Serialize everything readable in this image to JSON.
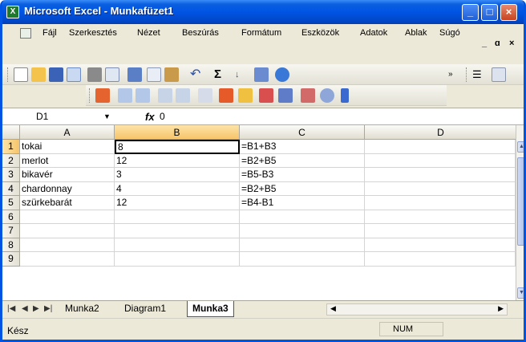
{
  "window": {
    "title": "Microsoft Excel - Munkafüzet1",
    "app_icon_glyph": "X",
    "minimize": "_",
    "maximize": "□",
    "close": "×"
  },
  "menu": {
    "items": [
      "Fájl",
      "Szerkesztés",
      "Nézet",
      "Beszúrás",
      "Formátum",
      "Eszközök",
      "Adatok",
      "Ablak",
      "Súgó"
    ],
    "doc_minimize": "_",
    "doc_restore": "ɑ",
    "doc_close": "×"
  },
  "toolbar": {
    "sigma": "Σ",
    "standard_icons": [
      "new-icon",
      "open-icon",
      "save-icon",
      "permission-icon",
      "print-icon",
      "print-preview-icon",
      "research-icon",
      "copy-icon",
      "paste-icon",
      "undo-icon",
      "autosum-icon",
      "sort-ascending-icon",
      "chart-icon",
      "help-icon"
    ],
    "formatting_icons": [
      "align-center-icon",
      "merge-icon"
    ],
    "drawing_icons": [
      "fill-color-icon",
      "indent-icon",
      "outdent-icon",
      "borders-icon",
      "font-color-icon",
      "insert-icon",
      "folder-icon",
      "table-icon",
      "chart-wizard-icon",
      "zoom-icon"
    ]
  },
  "formula_bar": {
    "name_box": "D1",
    "fx": "fx",
    "value": "0"
  },
  "sheet": {
    "columns": [
      "A",
      "B",
      "C",
      "D"
    ],
    "active_column": "B",
    "rows": [
      "1",
      "2",
      "3",
      "4",
      "5",
      "6",
      "7",
      "8",
      "9"
    ],
    "active_row": "1",
    "cells": [
      [
        "tokai",
        "8",
        "=B1+B3",
        ""
      ],
      [
        "merlot",
        "12",
        "=B2+B5",
        ""
      ],
      [
        "bikavér",
        "3",
        "=B5-B3",
        ""
      ],
      [
        "chardonnay",
        "4",
        "=B2+B5",
        ""
      ],
      [
        "szürkebarát",
        "12",
        "=B4-B1",
        ""
      ],
      [
        "",
        "",
        "",
        ""
      ],
      [
        "",
        "",
        "",
        ""
      ],
      [
        "",
        "",
        "",
        ""
      ],
      [
        "",
        "",
        "",
        ""
      ]
    ],
    "selected_cell": "B1"
  },
  "sheet_tabs": {
    "tabs": [
      "Munka2",
      "Diagram1",
      "Munka3"
    ],
    "active": "Munka3"
  },
  "status": {
    "text": "Kész",
    "num": "NUM"
  }
}
